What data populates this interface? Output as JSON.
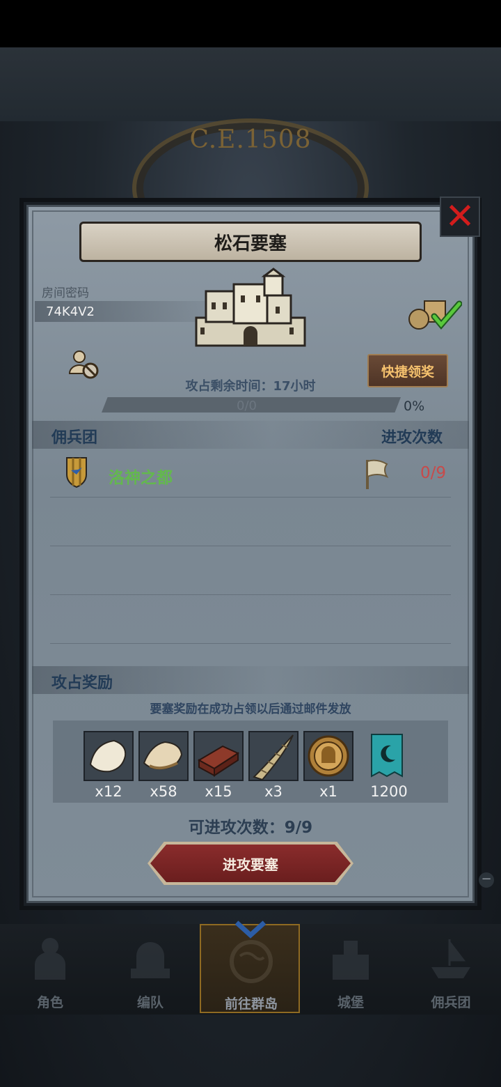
{
  "background": {
    "era_label": "C.E.1508"
  },
  "fortress": {
    "title": "松石要塞",
    "room_code_label": "房间密码",
    "room_code": "74K4V2",
    "quick_claim_label": "快捷领奖",
    "occupy_time_text": "攻占剩余时间：17小时",
    "progress": {
      "text": "0/0",
      "percent_text": "0%",
      "fraction": 0
    }
  },
  "mercenary_section": {
    "title": "佣兵团",
    "attacks_header": "进攻次数",
    "rows": [
      {
        "name": "洛神之都",
        "count": "0/9"
      }
    ]
  },
  "reward_section": {
    "title": "攻占奖励",
    "note": "要塞奖励在成功占领以后通过邮件发放",
    "items": [
      {
        "icon": "fur-pelt-icon",
        "qty": "x12"
      },
      {
        "icon": "leather-hide-icon",
        "qty": "x58"
      },
      {
        "icon": "wood-planks-icon",
        "qty": "x15"
      },
      {
        "icon": "horn-icon",
        "qty": "x3"
      },
      {
        "icon": "knight-medal-icon",
        "qty": "x1"
      },
      {
        "icon": "banner-icon",
        "qty": "1200"
      }
    ]
  },
  "attack": {
    "count_text": "可进攻次数：9/9",
    "button_label": "进攻要塞"
  },
  "nav": {
    "items": [
      {
        "label": "角色",
        "icon": "knight-icon"
      },
      {
        "label": "编队",
        "icon": "helmet-icon"
      },
      {
        "label": "前往群岛",
        "icon": "globe-icon",
        "active": true
      },
      {
        "label": "城堡",
        "icon": "castle-icon"
      },
      {
        "label": "佣兵团",
        "icon": "ship-icon"
      }
    ]
  },
  "colors": {
    "accent_gold": "#f5c16e",
    "merc_name_green": "#63b84e",
    "attack_count_red": "#c84a4a",
    "close_red": "#d21c1c",
    "attack_button": "#8a2c2c"
  }
}
